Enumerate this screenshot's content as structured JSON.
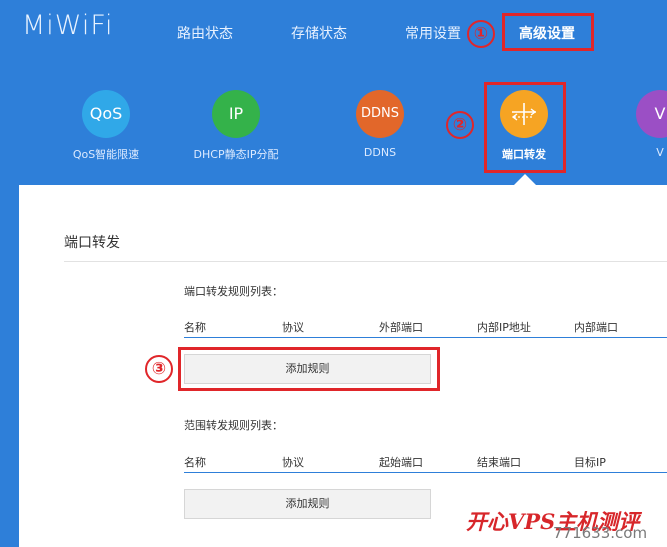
{
  "header": {
    "logo": "MiWiFi",
    "nav": [
      {
        "label": "路由状态"
      },
      {
        "label": "存储状态"
      },
      {
        "label": "常用设置"
      },
      {
        "label": "高级设置"
      }
    ]
  },
  "features": [
    {
      "icon": "QoS",
      "label": "QoS智能限速",
      "color": "#30a8e8"
    },
    {
      "icon": "IP",
      "label": "DHCP静态IP分配",
      "color": "#34b24a"
    },
    {
      "icon": "DDNS",
      "label": "DDNS",
      "color": "#e2672a"
    },
    {
      "icon": "port-forward-icon",
      "label": "端口转发",
      "color": "#f6a423"
    },
    {
      "icon": "V",
      "label": "V",
      "color": "#9b4fc5"
    }
  ],
  "callouts": [
    "①",
    "②",
    "③"
  ],
  "panel": {
    "title": "端口转发",
    "port_rules": {
      "title": "端口转发规则列表：",
      "columns": [
        "名称",
        "协议",
        "外部端口",
        "内部IP地址",
        "内部端口"
      ],
      "add_button": "添加规则"
    },
    "range_rules": {
      "title": "范围转发规则列表：",
      "columns": [
        "名称",
        "协议",
        "起始端口",
        "结束端口",
        "目标IP"
      ],
      "add_button": "添加规则"
    }
  },
  "watermark": {
    "text": "开心VPS主机测评",
    "url": "771633.com"
  },
  "colors": {
    "header_bg": "#2e7fd9",
    "callout_red": "#e0262a"
  }
}
